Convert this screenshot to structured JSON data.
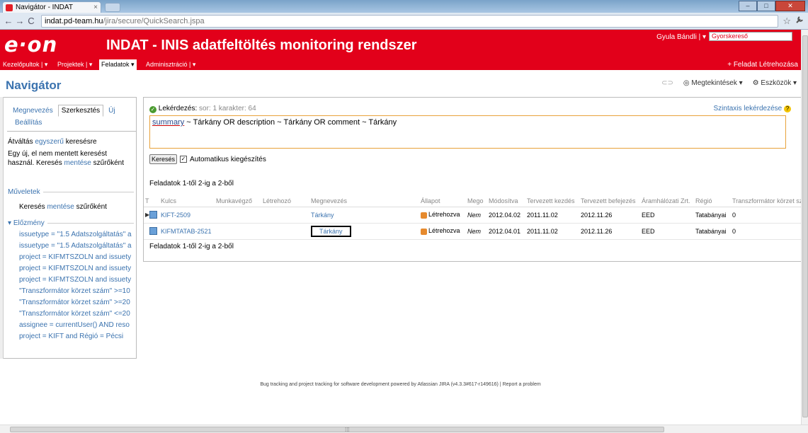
{
  "browser": {
    "tab_title": "Navigátor - INDAT",
    "tab_close": "×",
    "url_host": "indat.pd-team.hu",
    "url_path": "/jira/secure/QuickSearch.jspa",
    "back": "←",
    "forward": "→",
    "reload": "C",
    "star": "☆",
    "wrench": "🔧",
    "minimize": "–",
    "maximize": "□",
    "close": "✕"
  },
  "header": {
    "logo": "e·on",
    "title": "INDAT  -  INIS adatfeltöltés monitoring rendszer",
    "user": "Gyula Bándli | ▾",
    "quicksearch_placeholder": "Gyorskereső"
  },
  "menu": {
    "items": [
      "Kezelőpultok | ▾",
      "Projektek | ▾",
      "Feladatok  ▾",
      "Adminisztráció | ▾"
    ],
    "create_issue": "+ Feladat Létrehozása"
  },
  "page": {
    "title": "Navigátor",
    "views": "⊂⊃",
    "views_label": "◎ Megtekintések ▾",
    "tools_label": "⚙ Eszközök ▾"
  },
  "sidebar": {
    "tabs": [
      "Megnevezés",
      "Szerkesztés",
      "Új"
    ],
    "settings": "Beállítás",
    "switch_prefix": "Átváltás ",
    "switch_link": "egyszerű",
    "switch_suffix": " keresésre",
    "unsaved_1": "Egy új, el nem mentett keresést használ. Keresés ",
    "unsaved_link": "mentése",
    "unsaved_2": " szűrőként",
    "operations_title": "Műveletek",
    "save_prefix": "Keresés ",
    "save_link": "mentése",
    "save_suffix": " szűrőként",
    "history_title": "Előzmény",
    "history": [
      "issuetype = \"1.5 Adatszolgáltatás\" a",
      "issuetype = \"1.5 Adatszolgáltatás\" a",
      "project = KIFMTSZOLN and issuety",
      "project = KIFMTSZOLN and issuety",
      "project = KIFMTSZOLN and issuety",
      "\"Transzformátor körzet szám\" >=10",
      "\"Transzformátor körzet szám\" >=20",
      "\"Transzformátor körzet szám\" <=20",
      "assignee = currentUser() AND reso",
      "project = KIFT and Régió = Pécsi"
    ]
  },
  "query": {
    "label": "Lekérdezés:",
    "meta": " sor: 1  karakter: 64",
    "syntax_help": "Szintaxis lekérdezése",
    "text_kw": "summary",
    "text_rest": " ~ Tárkány OR description ~ Tárkány OR comment ~ Tárkány",
    "search_button": "Keresés",
    "autocomplete": "Automatikus kiegészítés",
    "check": "✓"
  },
  "results": {
    "count_text": "Feladatok 1-től 2-ig a 2-ből",
    "columns": [
      "T",
      "Kulcs",
      "Munkavégző",
      "Létrehozó",
      "Megnevezés",
      "Állapot",
      "Mego",
      "Módosítva",
      "Tervezett kezdés",
      "Tervezett befejezés",
      "Áramhálózati Zrt.",
      "Régió",
      "Transzformátor körzet szám"
    ],
    "rows": [
      {
        "key": "KIFT-2509",
        "assignee": "",
        "reporter": "",
        "summary": "Tárkány",
        "status": "Létrehozva",
        "resolution": "Nem",
        "updated": "2012.04.02",
        "start": "2011.11.02",
        "end": "2012.11.26",
        "company": "EED",
        "region": "Tatabányai",
        "district": "0"
      },
      {
        "key": "KIFMTATAB-2521",
        "assignee": "",
        "reporter": "",
        "summary": "Tárkány",
        "status": "Létrehozva",
        "resolution": "Nem",
        "updated": "2012.04.01",
        "start": "2011.11.02",
        "end": "2012.11.26",
        "company": "EED",
        "region": "Tatabányai",
        "district": "0"
      }
    ]
  },
  "footer": {
    "text": "Bug tracking and project tracking for software development powered by Atlassian JIRA (v4.3.3#617-r149616) | Report a problem"
  },
  "scrollbar": {
    "grip": "⁞⁞⁞"
  },
  "colors": {
    "brand": "#e2001a",
    "link": "#3b73af"
  }
}
